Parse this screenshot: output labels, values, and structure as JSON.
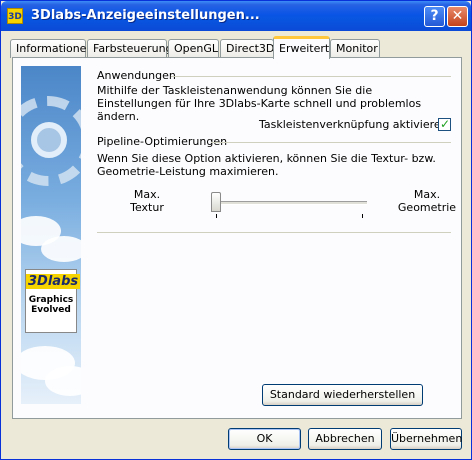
{
  "window": {
    "title": "3Dlabs-Anzeigeeinstellungen...",
    "icon_text": "3D",
    "help_label": "?",
    "close_label": "✕"
  },
  "tabs": [
    {
      "label": "Informationen",
      "active": false
    },
    {
      "label": "Farbsteuerung",
      "active": false
    },
    {
      "label": "OpenGL",
      "active": false
    },
    {
      "label": "Direct3D",
      "active": false
    },
    {
      "label": "Erweitert",
      "active": true
    },
    {
      "label": "Monitor",
      "active": false
    }
  ],
  "branding": {
    "logo_mark": "3Dlabs",
    "logo_line1": "Graphics",
    "logo_line2": "Evolved"
  },
  "applications": {
    "heading": "Anwendungen",
    "description": "Mithilfe der Taskleistenanwendung können Sie die Einstellungen für Ihre 3Dlabs-Karte schnell und problemlos ändern.",
    "checkbox_label": "Taskleistenverknüpfung aktivieren:",
    "checkbox_checked": true,
    "check_glyph": "✓"
  },
  "pipeline": {
    "heading": "Pipeline-Optimierungen",
    "description": "Wenn Sie diese Option aktivieren, können Sie die Textur- bzw. Geometrie-Leistung maximieren.",
    "left_label_1": "Max.",
    "left_label_2": "Textur",
    "right_label_1": "Max.",
    "right_label_2": "Geometrie",
    "slider_value": 0
  },
  "buttons": {
    "restore_defaults": "Standard wiederherstellen",
    "ok": "OK",
    "cancel": "Abbrechen",
    "apply": "Übernehmen"
  }
}
